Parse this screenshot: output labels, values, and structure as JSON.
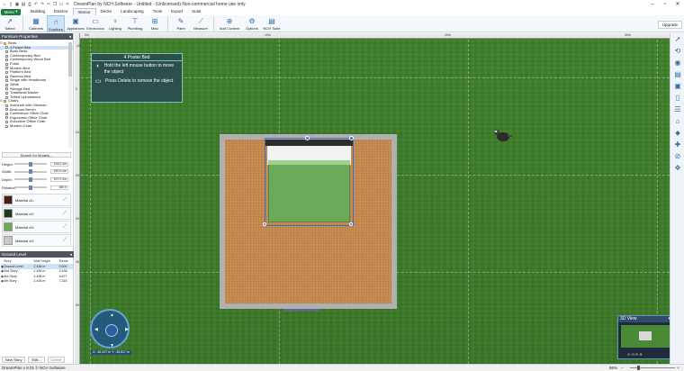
{
  "window": {
    "title": "DreamPlan by NCH Software - Untitled - (Unlicensed) Non-commercial home use only",
    "controls": [
      "minimize-icon",
      "maximize-icon",
      "close-icon"
    ]
  },
  "menubar": {
    "menu_label": "Menu",
    "tabs": [
      "Building",
      "Exterior",
      "Interior",
      "Decks",
      "Landscaping",
      "Tools",
      "Export",
      "Suite"
    ],
    "active_tab": "Interior",
    "help": "?"
  },
  "ribbon": {
    "buttons": [
      {
        "label": "Select",
        "icon": "cursor-icon"
      },
      {
        "label": "Cabinets",
        "icon": "cabinet-icon"
      },
      {
        "label": "Furniture",
        "icon": "chair-icon",
        "selected": true
      },
      {
        "label": "Appliances",
        "icon": "appliance-icon"
      },
      {
        "label": "Electronics",
        "icon": "tv-icon"
      },
      {
        "label": "Lighting",
        "icon": "lamp-icon"
      },
      {
        "label": "Plumbing",
        "icon": "faucet-icon"
      },
      {
        "label": "Misc",
        "icon": "misc-icon"
      },
      {
        "label": "Paint",
        "icon": "paint-icon"
      },
      {
        "label": "Measure",
        "icon": "ruler-icon"
      },
      {
        "label": "Add Content",
        "icon": "add-content-icon"
      },
      {
        "label": "Options",
        "icon": "gear-icon"
      },
      {
        "label": "NCH Suite",
        "icon": "suite-icon"
      }
    ],
    "upgrade": "Upgrade"
  },
  "furniture_panel": {
    "title": "Furniture Properties",
    "tree": [
      {
        "label": "Beds",
        "cat": true
      },
      {
        "label": "4 Poster Bed",
        "selected": true
      },
      {
        "label": "Bunk Beds"
      },
      {
        "label": "Contemporary Bed"
      },
      {
        "label": "Contemporary Wood Bed"
      },
      {
        "label": "Futon"
      },
      {
        "label": "Modern Bed"
      },
      {
        "label": "Platform Bed"
      },
      {
        "label": "Racecar Bed"
      },
      {
        "label": "Single with Headboard"
      },
      {
        "label": "Sleek"
      },
      {
        "label": "Storage Bed"
      },
      {
        "label": "Traditional Master"
      },
      {
        "label": "Tufted Upholstered"
      },
      {
        "label": "Chairs",
        "cat": true
      },
      {
        "label": "Armchair with Ottoman"
      },
      {
        "label": "Bedroom Bench"
      },
      {
        "label": "Conference Office Chair"
      },
      {
        "label": "Ergonomic Office Chair"
      },
      {
        "label": "Executive Office Chair"
      },
      {
        "label": "Modern Chair"
      }
    ],
    "search": "Search for Models...",
    "dims": [
      {
        "label": "Height:",
        "value": "134.0 cm"
      },
      {
        "label": "Width:",
        "value": "190.0 cm"
      },
      {
        "label": "Depth:",
        "value": "197.0 cm"
      },
      {
        "label": "Rotation:",
        "value": "180.0"
      }
    ],
    "materials": [
      {
        "label": "Material #1:",
        "color": "#4a1e12"
      },
      {
        "label": "Material #2:",
        "color": "#1e3a1a"
      },
      {
        "label": "Material #3:",
        "color": "#6aaa58"
      },
      {
        "label": "Material #4:",
        "color": "#c8c8c8"
      }
    ]
  },
  "level_panel": {
    "title": "Ground Level",
    "headers": [
      "Story",
      "Wall Height",
      "Elevat"
    ],
    "rows": [
      {
        "story": "Ground Level",
        "wall": "2.438 m",
        "elev": "0.000",
        "current": true
      },
      {
        "story": "2nd Story",
        "wall": "2.438 m",
        "elev": "2.438"
      },
      {
        "story": "3rd Story",
        "wall": "2.438 m",
        "elev": "4.877"
      },
      {
        "story": "4th Story",
        "wall": "2.438 m",
        "elev": "7.315"
      }
    ],
    "buttons": [
      "New Story",
      "Edit...",
      "Delete"
    ]
  },
  "canvas": {
    "ruler_top": [
      "0m",
      "10m",
      "20m",
      "30m"
    ],
    "ruler_left": [
      "-10",
      "0",
      "10",
      "20",
      "30",
      "40",
      "50"
    ],
    "tooltip": {
      "title": "4 Poster Bed",
      "line1": "Hold the left mouse button to move the object",
      "line2": "Press Delete to remove the object"
    },
    "coords": "X: -46.437 m   Y: -36.817 m",
    "view3d_title": "3D View"
  },
  "right_toolbar": [
    "select-icon",
    "rotate-icon",
    "camera-icon",
    "layers-icon",
    "cube-icon",
    "doorway-icon",
    "stairs-icon",
    "roof-icon",
    "tag-icon",
    "pin-icon",
    "compass-icon",
    "pan-icon"
  ],
  "status": {
    "text": "DreamPlan v 8.01 © NCH Software",
    "zoom": "86%"
  }
}
